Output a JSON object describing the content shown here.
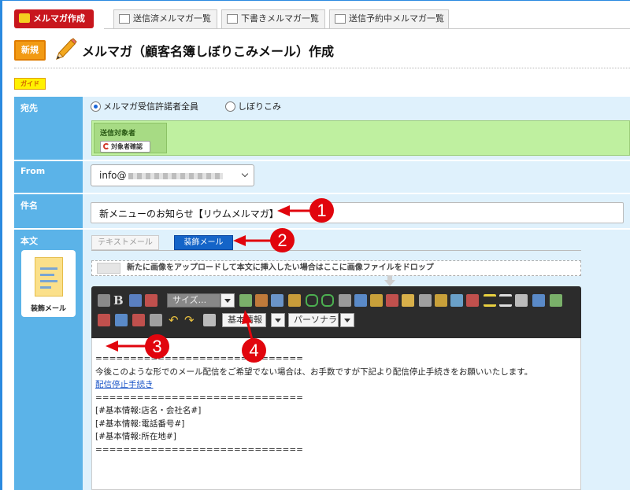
{
  "topbar": {
    "create_button": "メルマガ作成",
    "tabs": [
      "送信済メルマガ一覧",
      "下書きメルマガ一覧",
      "送信予約中メルマガ一覧"
    ]
  },
  "header": {
    "new_badge": "新規",
    "title": "メルマガ（顧客名簿しぼりこみメール）作成",
    "guide_badge": "ガイド"
  },
  "form": {
    "to": {
      "label": "宛先",
      "option_all": "メルマガ受信許諾者全員",
      "option_filter": "しぼりこみ",
      "selected": "メルマガ受信許諾者全員",
      "target_label": "送信対象者",
      "confirm_button": "対象者確認"
    },
    "from": {
      "label": "From",
      "value_prefix": "info@"
    },
    "subject": {
      "label": "件名",
      "value": "新メニューのお知らせ【リウムメルマガ】"
    },
    "body": {
      "label": "本文",
      "doc_label": "装飾メール",
      "text_mail_button": "テキストメール",
      "deco_mail_button": "装飾メール",
      "drop_hint": "新たに画像をアップロードして本文に挿入したい場合はここに画像ファイルをドロップ",
      "toolbar": {
        "style_select": "サイズ...",
        "basic_info_select": "基本情報",
        "persona_select": "パーソナラ"
      },
      "content": {
        "line1": "==============================",
        "line2": "今後このような形でのメール配信をご希望でない場合は、お手数ですが下記より配信停止手続きをお願いいたします。",
        "link": "配信停止手続き",
        "line3": "==============================",
        "line4": "[#基本情報:店名・会社名#]",
        "line5": "[#基本情報:電話番号#]",
        "line6": "[#基本情報:所在地#]",
        "line7": "=============================="
      }
    }
  },
  "callouts": [
    "1",
    "2",
    "3",
    "4"
  ],
  "colors": {
    "label_bg": "#5bb3e8",
    "form_bg": "#dff1fc",
    "callout": "#e1050d",
    "toolbar_bg": "#2c2c2c",
    "target_panel": "#bff0a0"
  }
}
